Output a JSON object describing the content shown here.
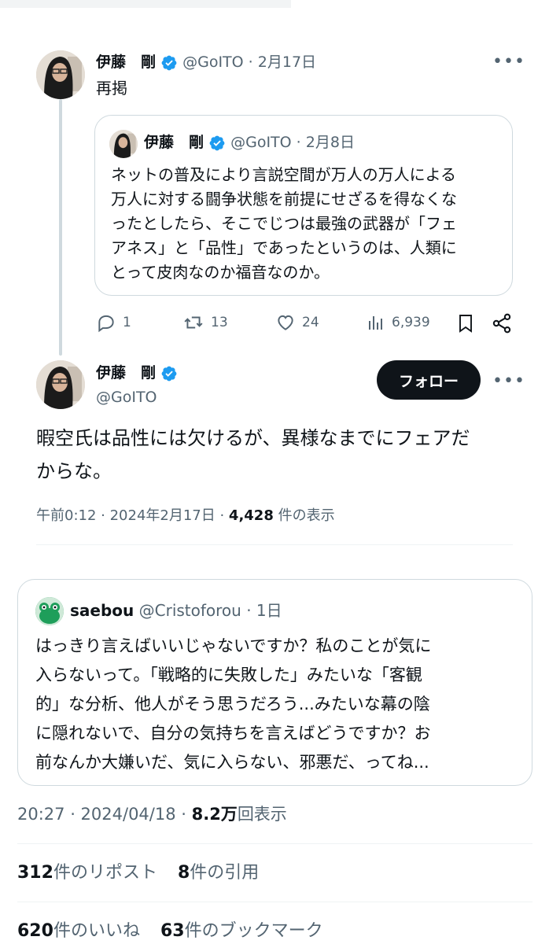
{
  "first_tweet": {
    "name": "伊藤　剛",
    "handle": "@GoITO",
    "date": "2月17日",
    "text": "再掲",
    "quoted": {
      "name": "伊藤　剛",
      "handle": "@GoITO",
      "date": "2月8日",
      "lines": [
        "ネットの普及により言説空間が万人の万人による",
        "万人に対する闘争状態を前提にせざるを得なくな",
        "ったとしたら、そこでじつは最強の武器が「フェ",
        "アネス」と「品性」であったというのは、人類に",
        "とって皮肉なのか福音なのか。"
      ]
    },
    "actions": {
      "reply_count": "1",
      "retweet_count": "13",
      "like_count": "24",
      "views_count": "6,939"
    }
  },
  "main_tweet": {
    "name": "伊藤　剛",
    "handle": "@GoITO",
    "follow_label": "フォロー",
    "lines": [
      "暇空氏は品性には欠けるが、異様なまでにフェアだ",
      "からな。"
    ],
    "timestamp": "午前0:12 · 2024年2月17日 · ",
    "views_number": "4,428",
    "views_suffix": " 件の表示"
  },
  "quote_tweet": {
    "name": "saebou",
    "handle": "@Cristoforou",
    "date": "1日",
    "lines": [
      "はっきり言えばいいじゃないですか？私のことが気に",
      "入らないって。「戦略的に失敗した」みたいな「客観",
      "的」な分析、他人がそう思うだろう...みたいな幕の陰",
      "に隠れないで、自分の気持ちを言えばどうですか？お",
      "前なんか大嫌いだ、気に入らない、邪悪だ、ってね..."
    ]
  },
  "footer": {
    "timestamp": "20:27 · 2024/04/18 · ",
    "views_number": "8.2万",
    "views_suffix": "回表示",
    "reposts_number": "312",
    "reposts_label": "件のリポスト",
    "quotes_number": "8",
    "quotes_label": "件の引用",
    "likes_number": "620",
    "likes_label": "件のいいね",
    "bookmarks_number": "63",
    "bookmarks_label": "件のブックマーク"
  },
  "colors": {
    "verified": "#1d9bf0",
    "text": "#0f1419",
    "secondary": "#536471",
    "border": "#cfd9de",
    "saebou_avatar": "#1e9e5a"
  }
}
